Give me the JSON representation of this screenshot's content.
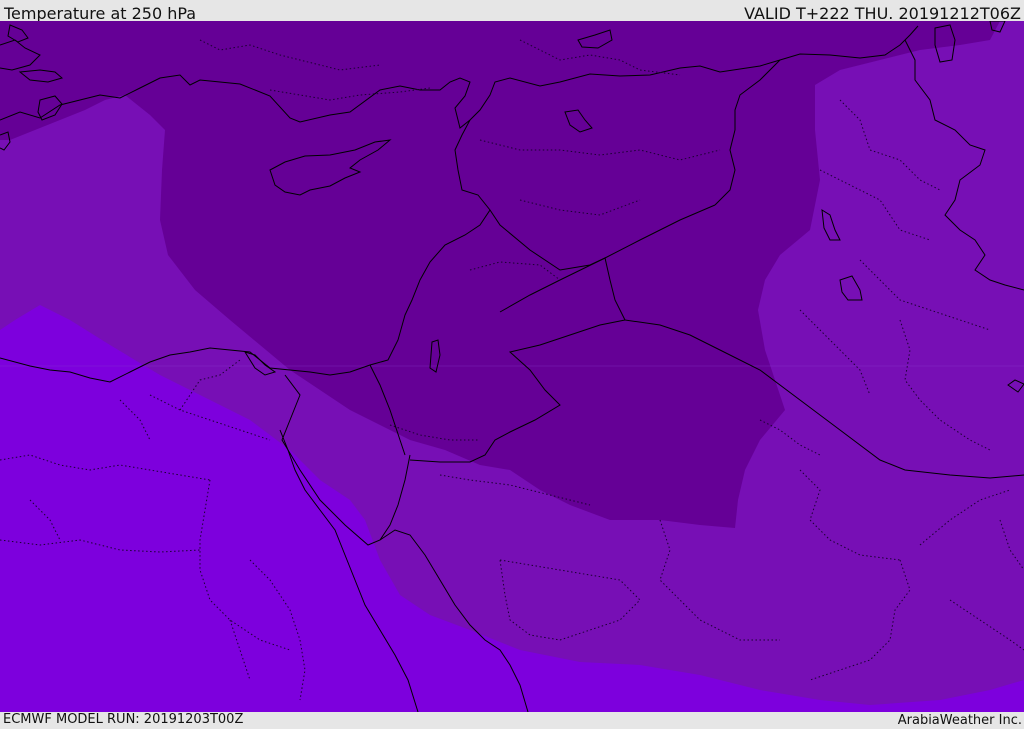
{
  "header": {
    "title": "Temperature at 250 hPa",
    "valid_time": "VALID T+222 THU. 20191212T06Z"
  },
  "footer": {
    "model_run": "ECMWF MODEL RUN: 20191203T00Z",
    "credit": "ArabiaWeather Inc."
  },
  "map": {
    "colors": {
      "coldest_band": "#650096",
      "middle_band": "#770fb5",
      "warm_band": "#7d00dd",
      "coastline": "#000000",
      "border": "#000000",
      "internal_border": "#1a0030"
    }
  }
}
